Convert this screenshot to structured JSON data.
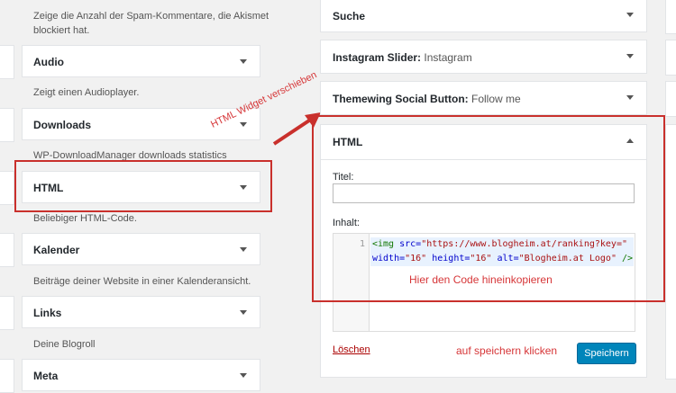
{
  "left": {
    "top_desc": "Zeige die Anzahl der Spam-Kommentare, die Akismet blockiert hat.",
    "widgets": [
      {
        "title": "Audio",
        "desc": "Zeigt einen Audioplayer."
      },
      {
        "title": "Downloads",
        "desc": "WP-DownloadManager downloads statistics"
      },
      {
        "title": "HTML",
        "desc": "Beliebiger HTML-Code."
      },
      {
        "title": "Kalender",
        "desc": "Beiträge deiner Website in einer Kalenderansicht."
      },
      {
        "title": "Links",
        "desc": "Deine Blogroll"
      },
      {
        "title": "Meta",
        "desc": ""
      }
    ]
  },
  "right": {
    "widgets": [
      {
        "title": "Suche",
        "sub": ""
      },
      {
        "title": "Instagram Slider:",
        "sub": " Instagram"
      },
      {
        "title": "Themewing Social Button:",
        "sub": " Follow me"
      }
    ],
    "html_widget": {
      "title": "HTML",
      "title_label": "Titel:",
      "title_value": "",
      "content_label": "Inhalt:",
      "line_number": "1",
      "code_line1_tag": "<img",
      "code_line1_attr": " src=",
      "code_line1_str": "\"https://www.blogheim.at/ranking?key=\"",
      "code_line2_attr1": "width=",
      "code_line2_str1": "\"16\"",
      "code_line2_attr2": " height=",
      "code_line2_str2": "\"16\"",
      "code_line2_attr3": " alt=",
      "code_line2_str3": "\"Blogheim.at Logo\"",
      "code_line2_end": " />",
      "delete_label": "Löschen",
      "save_label": "Speichern"
    }
  },
  "annotations": {
    "drag_hint": "HTML Widget verschieben",
    "paste_hint": "Hier den Code hineinkopieren",
    "save_hint": "auf speichern klicken",
    "color": "#d63638"
  },
  "colors": {
    "primary_button": "#0085ba",
    "annotation_box": "#c9302c"
  }
}
